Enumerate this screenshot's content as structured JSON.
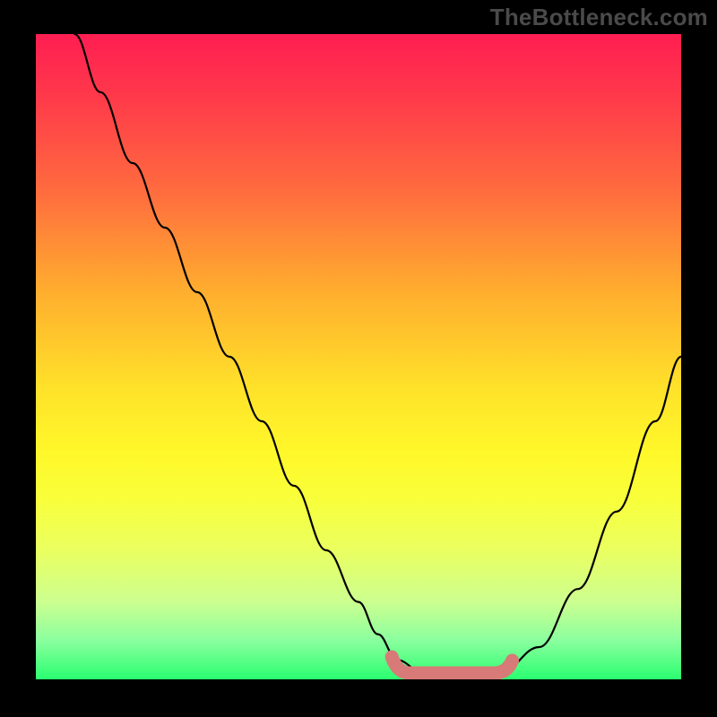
{
  "watermark": "TheBottleneck.com",
  "chart_data": {
    "type": "line",
    "title": "",
    "xlabel": "",
    "ylabel": "",
    "xlim": [
      0,
      100
    ],
    "ylim": [
      0,
      100
    ],
    "series": [
      {
        "name": "bottleneck-curve",
        "x": [
          6,
          10,
          15,
          20,
          25,
          30,
          35,
          40,
          45,
          50,
          53,
          56,
          60,
          63,
          66,
          69,
          72,
          78,
          84,
          90,
          96,
          100
        ],
        "values": [
          100,
          91,
          80,
          70,
          60,
          50,
          40,
          30,
          20,
          12,
          7,
          3,
          1,
          0,
          0,
          0,
          1,
          5,
          14,
          26,
          40,
          50
        ]
      }
    ],
    "flat_region": {
      "x_start": 56,
      "x_end": 73,
      "value": 0,
      "color": "#d87a77"
    },
    "legend": false
  }
}
